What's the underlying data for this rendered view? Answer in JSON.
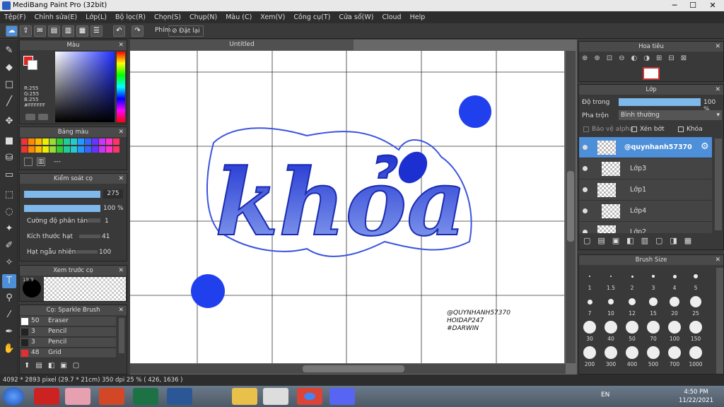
{
  "window": {
    "title": "MediBang Paint Pro (32bit)",
    "minimize": "─",
    "maximize": "☐",
    "close": "✕"
  },
  "menu": [
    "Tệp(F)",
    "Chỉnh sửa(E)",
    "Lớp(L)",
    "Bộ lọc(R)",
    "Chọn(S)",
    "Chụp(N)",
    "Màu (C)",
    "Xem(V)",
    "Công cụ(T)",
    "Cửa sổ(W)",
    "Cloud",
    "Help"
  ],
  "toolbar": {
    "key_label": "Phím",
    "reset_label": "Đặt lại"
  },
  "color_panel": {
    "title": "Màu",
    "r": "R:255",
    "g": "G:255",
    "b": "B:255",
    "hex": "#FFFFFF"
  },
  "palette_panel": {
    "title": "Bảng màu",
    "more": "---"
  },
  "brush_control": {
    "title": "Kiểm soát cọ",
    "size": "275",
    "opacity": "100 %",
    "scatter_label": "Cường độ phân tán",
    "scatter_value": "1",
    "particle_label": "Kích thước hạt",
    "particle_value": "41",
    "random_label": "Hạt ngẫu nhiên",
    "random_value": "100"
  },
  "preview": {
    "title": "Xem trước cọ",
    "size": "19.9"
  },
  "brush_list": {
    "title": "Cọ: Sparkle Brush",
    "items": [
      {
        "size": "50",
        "name": "Eraser",
        "color": "#ffffff"
      },
      {
        "size": "3",
        "name": "Pencil",
        "color": "#222222"
      },
      {
        "size": "3",
        "name": "Pencil",
        "color": "#222222"
      },
      {
        "size": "48",
        "name": "Grid",
        "color": "#e03030"
      }
    ]
  },
  "document": {
    "tab": "Untitled",
    "lettering": "khỏa",
    "watermark": [
      "@QUYNHANH57370",
      "HOIDAP247",
      "#DARWIN"
    ]
  },
  "navigator": {
    "title": "Hoa tiêu"
  },
  "layer_panel": {
    "title": "Lớp",
    "opacity_label": "Độ trong",
    "opacity_value": "100 %",
    "blend_label": "Pha trộn",
    "blend_value": "Bình thường",
    "protect_alpha": "Bảo vệ alpha",
    "clipping": "Xén bớt",
    "lock": "Khóa",
    "layers": [
      "@quynhanh57370",
      "Lớp3",
      "Lớp1",
      "Lớp4",
      "Lớp2"
    ]
  },
  "brush_size": {
    "title": "Brush Size",
    "sizes": [
      "1",
      "1.5",
      "2",
      "3",
      "4",
      "5",
      "7",
      "10",
      "12",
      "15",
      "20",
      "25",
      "30",
      "40",
      "50",
      "70",
      "100",
      "150",
      "200",
      "300",
      "400",
      "500",
      "700",
      "1000"
    ]
  },
  "status": {
    "text": "4092 * 2893 pixel   (29.7 * 21cm)   350 dpi   25 %   ( 426, 1636 )"
  },
  "taskbar": {
    "lang": "EN",
    "time": "4:50 PM",
    "date": "11/22/2021"
  },
  "colors": {
    "accent": "#4d8fd8",
    "lettering": "#2846d8",
    "layer_selected": "#4d8fd8"
  }
}
